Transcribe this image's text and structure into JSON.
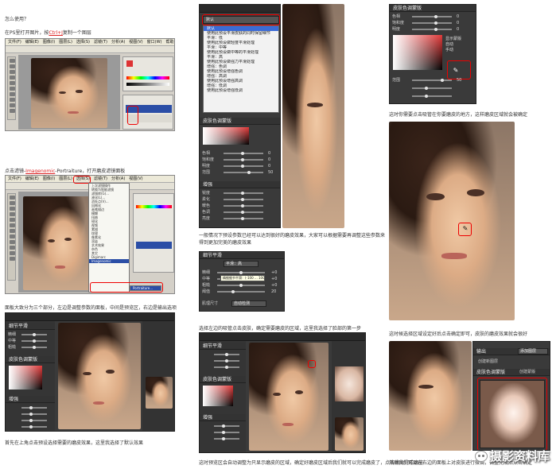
{
  "captions": {
    "c1": "怎么使用？",
    "c2a": "在PS里打开图片，按",
    "c2b": "Ctrl+J",
    "c2c": "复制一个图层",
    "c3a": "点击滤镜-",
    "c3b": "Imagenomic",
    "c3c": "-Portraiture，打开磨皮滤镜面板",
    "c4": "面板大致分为三个部分，左边是调整参数的面板，中间是预览区，右边是输出选项",
    "c5": "首先在上角点击预设选择需要的磨皮效果，这里我选择了默认效果",
    "c6": "一般情况下预设参数已经可以达到很好的磨皮效果，大家可以根据需要再调整这些参数来得到更加完美的磨皮效果",
    "c7": "选择左边的吸管点击皮肤，确定需要磨皮的区域，这里我选择了脸部的第一步",
    "c8": "这时预览区会自动调整为只显示磨皮的区域，确定好磨皮区域后我们就可以完成磨皮了，点击输出完成磨皮",
    "c9": "这时你需要点击吸管在你要磨皮的地方，这样磨皮区域就会被确定",
    "c10": "这时候选择区域设定好后点击确定即可，皮肤的磨皮效果就会很好",
    "c11": "然后我们可以在右边的面板上对皮肤进行微调，调整完成后点击确定"
  },
  "ps_menu": [
    "文件(F)",
    "编辑(E)",
    "图像(I)",
    "图层(L)",
    "选择(S)",
    "滤镜(T)",
    "分析(A)",
    "视图(V)",
    "窗口(W)",
    "帮助(H)"
  ],
  "filter_menu": [
    "上次滤镜操作",
    "转换为智能滤镜",
    "滤镜库(G)...",
    "液化(L)...",
    "消失点(V)...",
    "风格化",
    "画笔描边",
    "模糊",
    "扭曲",
    "锐化",
    "视频",
    "素描",
    "纹理",
    "像素化",
    "渲染",
    "艺术效果",
    "杂色",
    "其它",
    "Digimarc",
    "Imagenomic"
  ],
  "filter_sub": "Portraiture...",
  "presets_title": "默认",
  "presets": [
    {
      "name": "默认",
      "desc": "使用此预设平滑皮肤的同时保留细节"
    },
    {
      "name": "平滑：低",
      "desc": "使用此预设做轻度平滑处理"
    },
    {
      "name": "平滑：中等",
      "desc": "使用此预设做中等的平滑处理"
    },
    {
      "name": "平滑：高",
      "desc": "使用此预设做强力平滑处理"
    },
    {
      "name": "增强：色调",
      "desc": "使用此预设增强色调"
    },
    {
      "name": "增强：高调",
      "desc": "使用此预设增强高调"
    },
    {
      "name": "增强：低调",
      "desc": "使用此预设增强低调"
    }
  ],
  "panel_sections": {
    "detail": "细节平滑",
    "mask": "皮肤色调蒙版",
    "enhance": "增强",
    "output": "输出"
  },
  "detail_rows": [
    {
      "label": "精细",
      "value": "+0"
    },
    {
      "label": "中等",
      "value": "+0"
    },
    {
      "label": "粗糙",
      "value": "+0"
    },
    {
      "label": "阈值",
      "value": "20"
    }
  ],
  "enhance_rows": [
    {
      "label": "锐度",
      "value": "0"
    },
    {
      "label": "柔化",
      "value": "0"
    },
    {
      "label": "暖色",
      "value": "0"
    },
    {
      "label": "色调",
      "value": "0"
    },
    {
      "label": "亮度",
      "value": "0"
    },
    {
      "label": "对比度",
      "value": "0"
    }
  ],
  "mask_rows": [
    {
      "label": "色相",
      "value": "0"
    },
    {
      "label": "饱和度",
      "value": "0"
    },
    {
      "label": "明度",
      "value": "0"
    },
    {
      "label": "范围",
      "value": "50"
    }
  ],
  "detail_preset_label": "平滑：高",
  "detail_tooltip": "精细细节平滑：(-100 ... 100)",
  "size_label": "肌理尺寸",
  "size_value": "自动检测",
  "mask_opts": [
    "显示蒙版",
    "自动",
    "手动"
  ],
  "mask_checkbox": "创建蒙版",
  "output_checkbox": "创建新图层",
  "output_select": "添加图层",
  "watermark": "摄影资料库",
  "colors": {
    "accent_red": "#e00000",
    "dark_panel": "#3a3a3a"
  }
}
